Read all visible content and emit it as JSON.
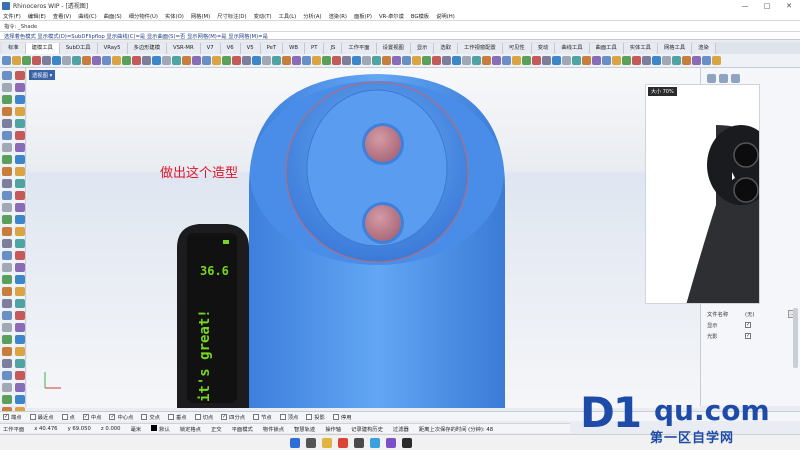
{
  "window": {
    "title": "Rhinoceros WIP - [透视图]",
    "controls": [
      "—",
      "□",
      "✕"
    ]
  },
  "menu": [
    "文件(F)",
    "编辑(E)",
    "查看(V)",
    "曲线(C)",
    "曲面(S)",
    "细分物件(U)",
    "实体(O)",
    "网格(M)",
    "尺寸标注(D)",
    "变动(T)",
    "工具(L)",
    "分析(A)",
    "渲染(R)",
    "面板(P)",
    "VR-卓尔谟",
    "BG模板",
    "说明(H)"
  ],
  "command": {
    "history": "指令: _Shade",
    "prompt": "选择着色模式 显示模式(D)=SubDFlipflop 显示曲线(C)=是 显示曲面(S)=否 显示网格(M)=是 显示网格(M)=是"
  },
  "tabs": [
    "标准",
    "建模工具",
    "SubD工具",
    "VRay5",
    "多边形建模",
    "VSR-MR",
    "V7",
    "V6",
    "V5",
    "PeT",
    "WB",
    "PT",
    "JS",
    "工作平面",
    "设置视图",
    "显示",
    "选取",
    "工作视窗配置",
    "可见性",
    "变动",
    "曲线工具",
    "曲面工具",
    "实体工具",
    "网格工具",
    "渲染"
  ],
  "tabs_active_index": 1,
  "viewport": {
    "label": "透视图 ▾",
    "annotation": "做出这个造型",
    "device_readout": "36.6",
    "device_slogan": "it's great!"
  },
  "reference": {
    "zoom": "大小 70%"
  },
  "properties": {
    "rows": [
      {
        "label": "文件名称",
        "value": "(无)"
      },
      {
        "label": "显示",
        "value": "✓"
      },
      {
        "label": "光影",
        "value": "✓"
      }
    ],
    "button": "..."
  },
  "osnaps": [
    {
      "label": "端点",
      "checked": true
    },
    {
      "label": "最近点",
      "checked": false
    },
    {
      "label": "点",
      "checked": false
    },
    {
      "label": "中点",
      "checked": true
    },
    {
      "label": "中心点",
      "checked": true
    },
    {
      "label": "交点",
      "checked": false
    },
    {
      "label": "垂点",
      "checked": false
    },
    {
      "label": "切点",
      "checked": false
    },
    {
      "label": "四分点",
      "checked": true
    },
    {
      "label": "节点",
      "checked": false
    },
    {
      "label": "顶点",
      "checked": false
    },
    {
      "label": "投影",
      "checked": false
    },
    {
      "label": "停用",
      "checked": false
    }
  ],
  "status": {
    "cplane": "工作平面",
    "x": "x 40.476",
    "y": "y 69.050",
    "z": "z 0.000",
    "unit": "毫米",
    "layer": "默认",
    "toggles": [
      "锁定格点",
      "正交",
      "平面模式",
      "物件锁点",
      "智慧轨迹",
      "操作轴",
      "记录建构历史",
      "过滤器",
      "距离上次保存的时间 (分钟): 48"
    ]
  },
  "watermark": {
    "brand": "D1",
    "suffix": "qu.com",
    "tagline": "第一区自学网"
  },
  "colors": {
    "model_blue": "#4d93ee",
    "disc_pink": "#c77d8b",
    "device_dark": "#1c1c1e",
    "lcd_green": "#78d61e",
    "annotation_red": "#e0152a",
    "brand_blue": "#1e4aa8"
  }
}
